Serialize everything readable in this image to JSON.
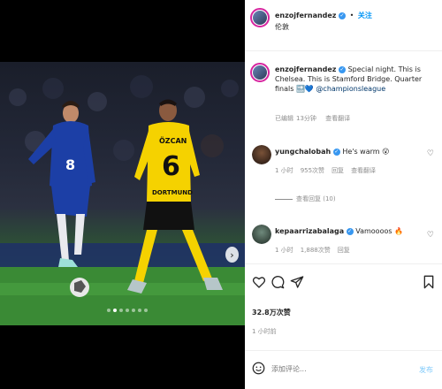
{
  "header": {
    "username": "enzojfernandez",
    "separator": "•",
    "follow_label": "关注",
    "location": "伦敦"
  },
  "caption": {
    "username": "enzojfernandez",
    "text": "Special night. This is Chelsea. This is Stamford Bridge. Quarter finals 🔜💙",
    "mention": "@championsleague",
    "edited": "已编辑",
    "time": "13分钟",
    "translate": "查看翻译"
  },
  "comments": [
    {
      "username": "yungchalobah",
      "text": "He's warm 😮",
      "time": "1 小时",
      "likes": "955次赞",
      "reply": "回复",
      "translate": "查看翻译",
      "view_replies": "查看回复 (10)",
      "avatar_color": "#3a2a20"
    },
    {
      "username": "kepaarrizabalaga",
      "text": "Vamoooos 🔥",
      "time": "1 小时",
      "likes": "1,888次赞",
      "reply": "回复",
      "avatar_color": "#2f3b34"
    }
  ],
  "actions": {
    "likes": "32.8万次赞",
    "time": "1 小时前"
  },
  "composer": {
    "placeholder": "添加评论...",
    "post_label": "发布"
  },
  "photo": {
    "left_jersey_number": "8",
    "right_player_name": "ÖZCAN",
    "right_jersey_number": "6",
    "right_jersey_sponsor": "DORTMUND",
    "carousel_total": 7,
    "carousel_active": 2
  },
  "colors": {
    "accent_blue": "#0095f6",
    "verified": "#3897f0",
    "story_ring": "#d6249f",
    "chelsea_blue": "#1c3fa6",
    "dortmund_yellow": "#f5d200"
  }
}
